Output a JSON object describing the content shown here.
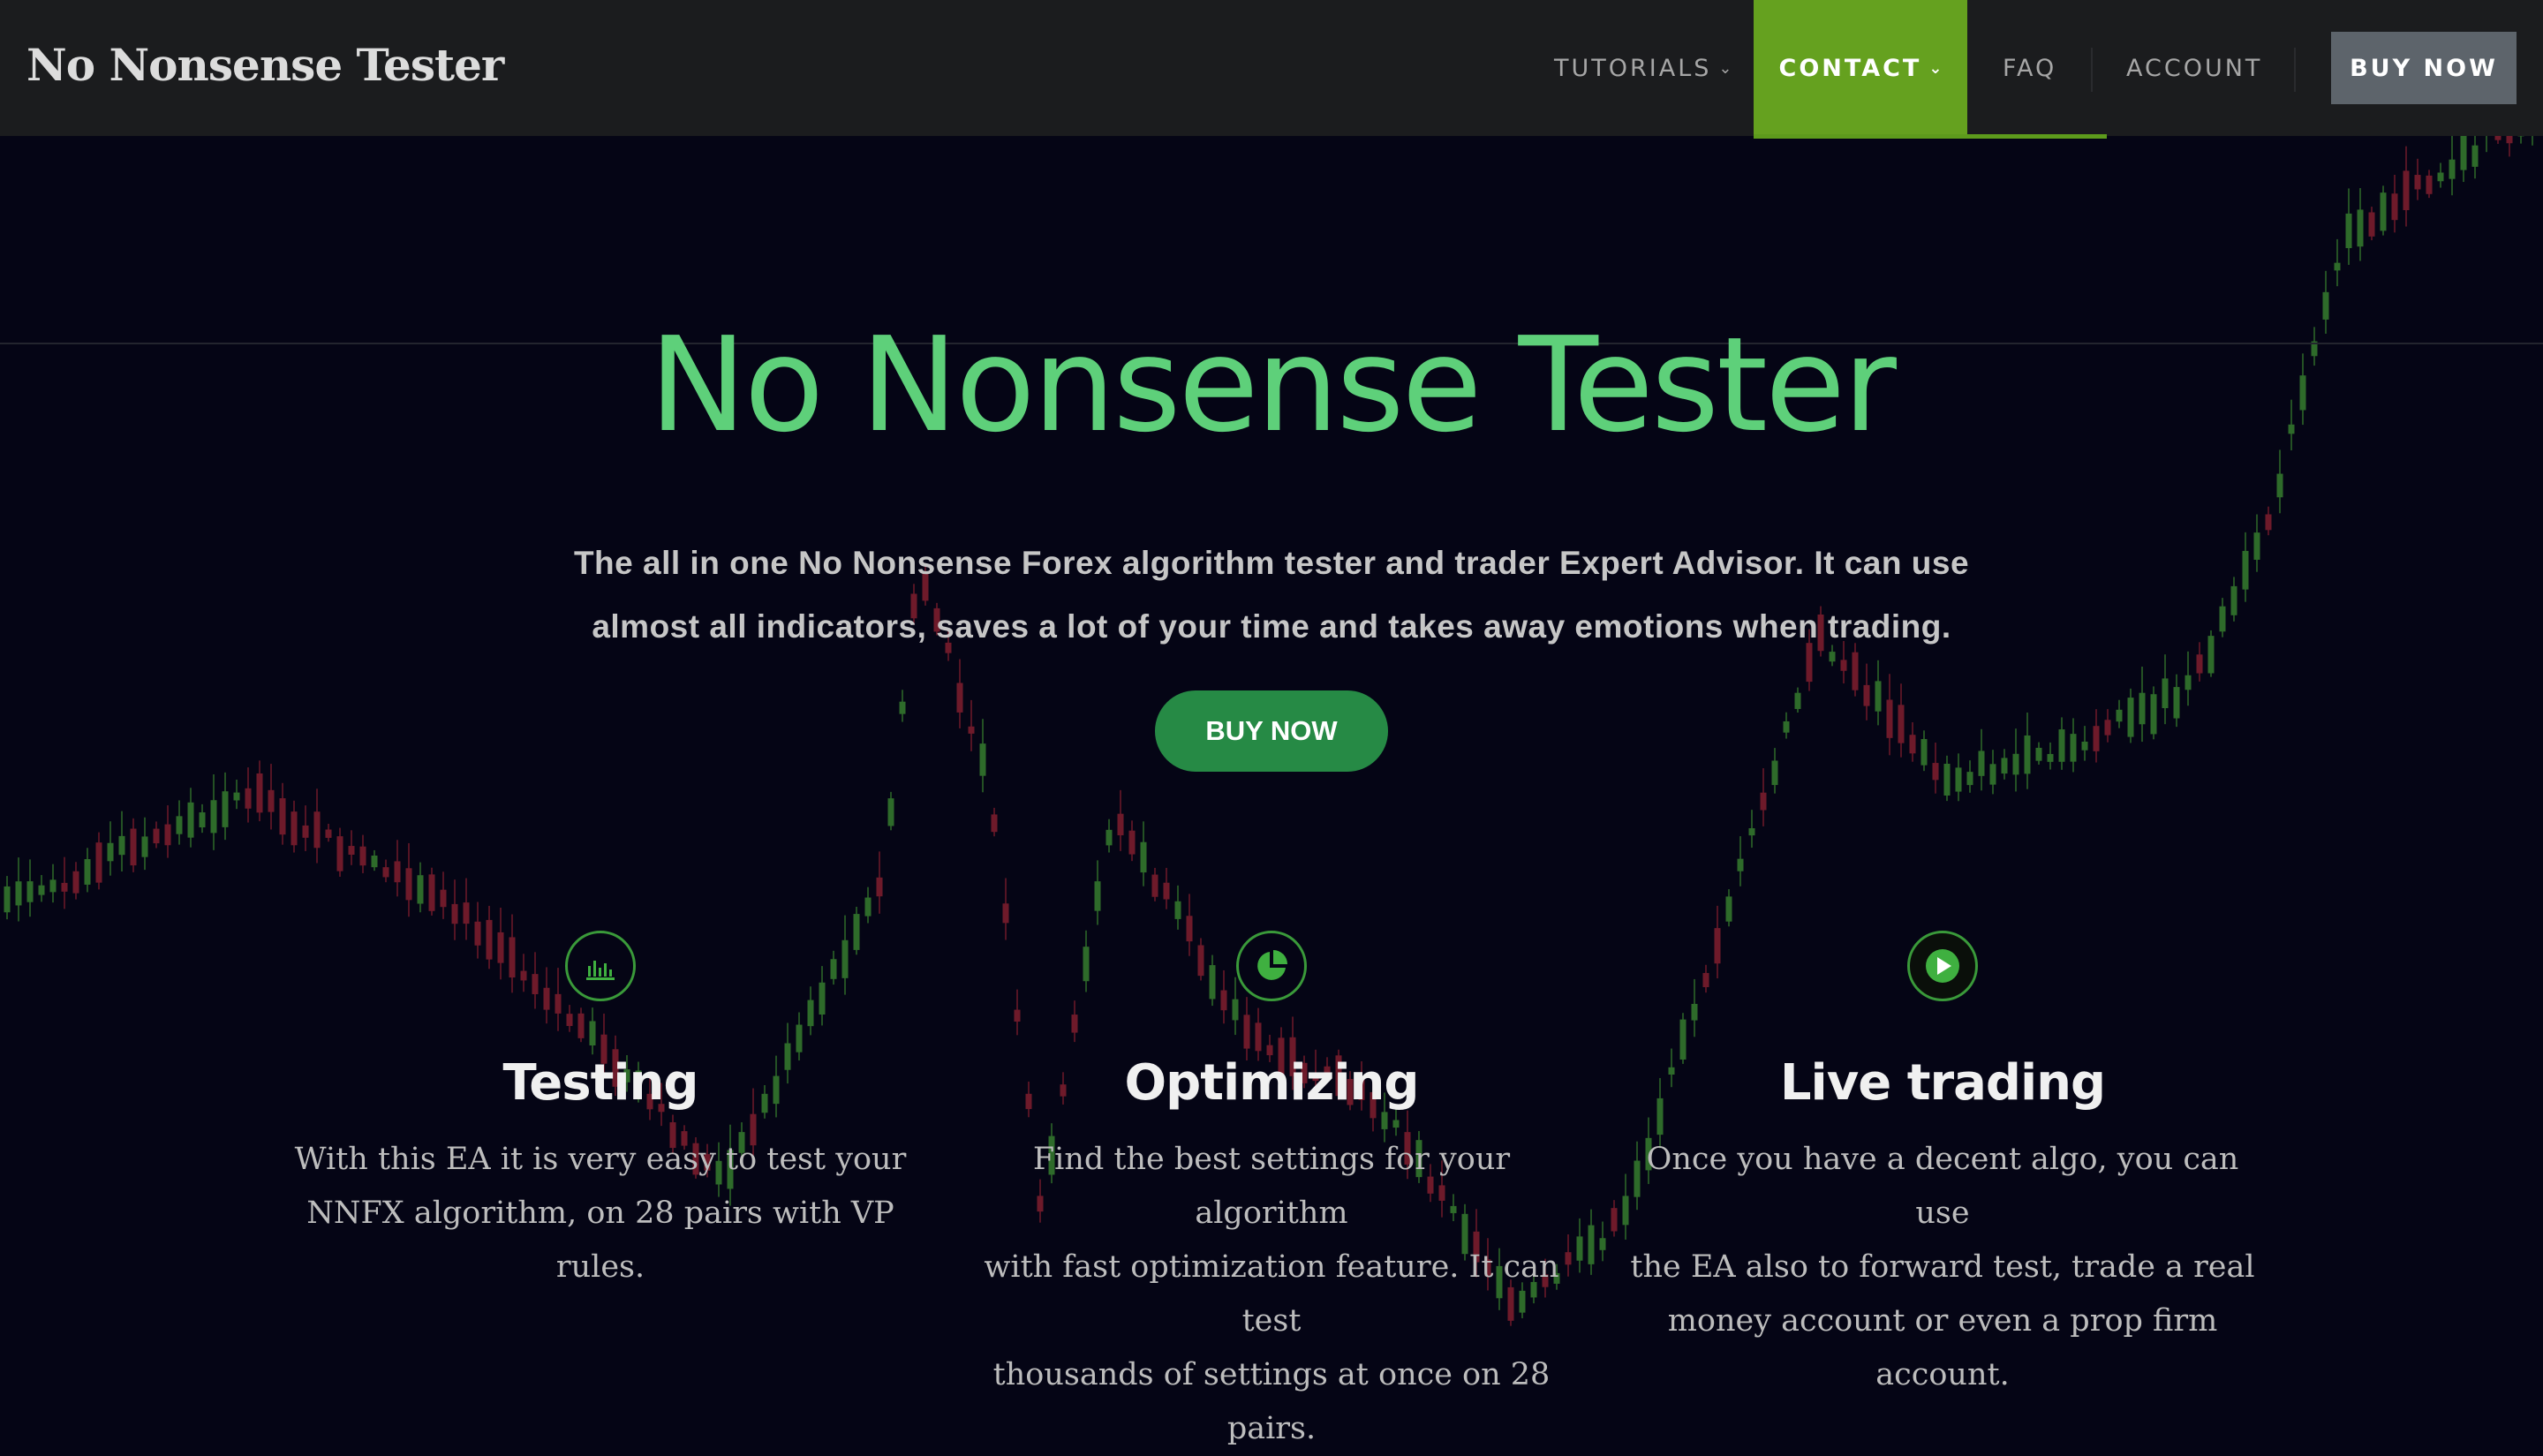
{
  "header": {
    "brand": "No Nonsense Tester",
    "nav": {
      "tutorials": "TUTORIALS",
      "contact": "CONTACT",
      "faq": "FAQ",
      "account": "ACCOUNT"
    },
    "buy_now": "BUY NOW"
  },
  "hero": {
    "title": "No Nonsense Tester",
    "subtitle_line1": "The all in one No Nonsense Forex algorithm tester and trader Expert Advisor. It can use",
    "subtitle_line2": "almost all indicators, saves a lot of your time and takes away emotions when trading.",
    "buy_now": "BUY NOW"
  },
  "features": [
    {
      "icon": "bar-chart-icon",
      "title": "Testing",
      "text_lines": [
        "With this EA it is very easy to test your",
        "NNFX algorithm, on 28 pairs with VP rules."
      ]
    },
    {
      "icon": "pie-chart-icon",
      "title": "Optimizing",
      "text_lines": [
        "Find the best settings for your algorithm",
        "with fast optimization feature. It can test",
        "thousands of settings at once on 28 pairs."
      ]
    },
    {
      "icon": "play-icon",
      "title": "Live trading",
      "text_lines": [
        "Once you have a decent algo, you can use",
        "the EA also to forward test, trade a real",
        "money account or even a prop firm",
        "account."
      ]
    }
  ],
  "colors": {
    "accent_green": "#5ed07a",
    "nav_active": "#65a11f",
    "button_green": "#268a45",
    "candle_up": "#2e6b2a",
    "candle_down": "#6e1a2a",
    "background": "#050515"
  }
}
